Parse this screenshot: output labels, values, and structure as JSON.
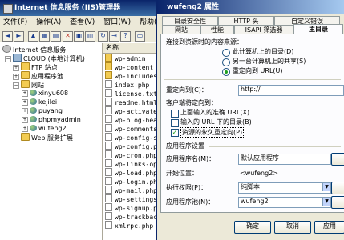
{
  "main_window": {
    "title": "Internet 信息服务 (IIS)管理器",
    "menu": [
      "文件(F)",
      "操作(A)",
      "查看(V)",
      "窗口(W)",
      "帮助(H)"
    ]
  },
  "tree": {
    "root": "Internet 信息服务",
    "server": "CLOUD (本地计算机)",
    "ftp": "FTP 站点",
    "app_pools": "应用程序池",
    "websites": "网站",
    "sites": [
      "xinyu608",
      "kejilei",
      "puyang",
      "phpmyadmin",
      "wufeng2"
    ],
    "extensions": "Web 服务扩展"
  },
  "files": {
    "header": "名称",
    "items": [
      "wp-admin",
      "wp-content",
      "wp-includes",
      "index.php",
      "license.txt",
      "readme.html",
      "wp-activate.php",
      "wp-blog-header.php",
      "wp-comments-post.php",
      "wp-config-sample.php",
      "wp-config.php",
      "wp-cron.php",
      "wp-links-opml.php",
      "wp-load.php",
      "wp-login.php",
      "wp-mail.php",
      "wp-settings.php",
      "wp-signup.php",
      "wp-trackback.php",
      "xmlrpc.php"
    ]
  },
  "dialog": {
    "title": "wufeng2 属性",
    "tabs_row1": [
      "目录安全性",
      "HTTP 头",
      "自定义错误"
    ],
    "tabs_row2": [
      "网站",
      "性能",
      "ISAPI 筛选器",
      "主目录"
    ],
    "content_source_label": "连接到资源时的内容来源：",
    "radio_options": [
      "此计算机上的目录(D)",
      "另一台计算机上的共享(S)",
      "重定向到 URL(U)"
    ],
    "redirect_label": "重定向到(C)：",
    "redirect_value": "http://",
    "client_send_label": "客户端将定向到：",
    "checkbox_options": [
      "上面输入的准确 URL(X)",
      "输入的 URL 下的目录(B)",
      "资源的永久重定向(P)"
    ],
    "app_settings_label": "应用程序设置",
    "app_name_label": "应用程序名(M)：",
    "app_name_value": "默认应用程序",
    "start_point_label": "开始位置：",
    "start_point_value": "<wufeng2>",
    "exec_perm_label": "执行权限(P)：",
    "exec_perm_value": "纯脚本",
    "app_pool_label": "应用程序池(N)：",
    "app_pool_value": "wufeng2",
    "buttons": {
      "ok": "确定",
      "cancel": "取消",
      "apply": "应用"
    }
  }
}
